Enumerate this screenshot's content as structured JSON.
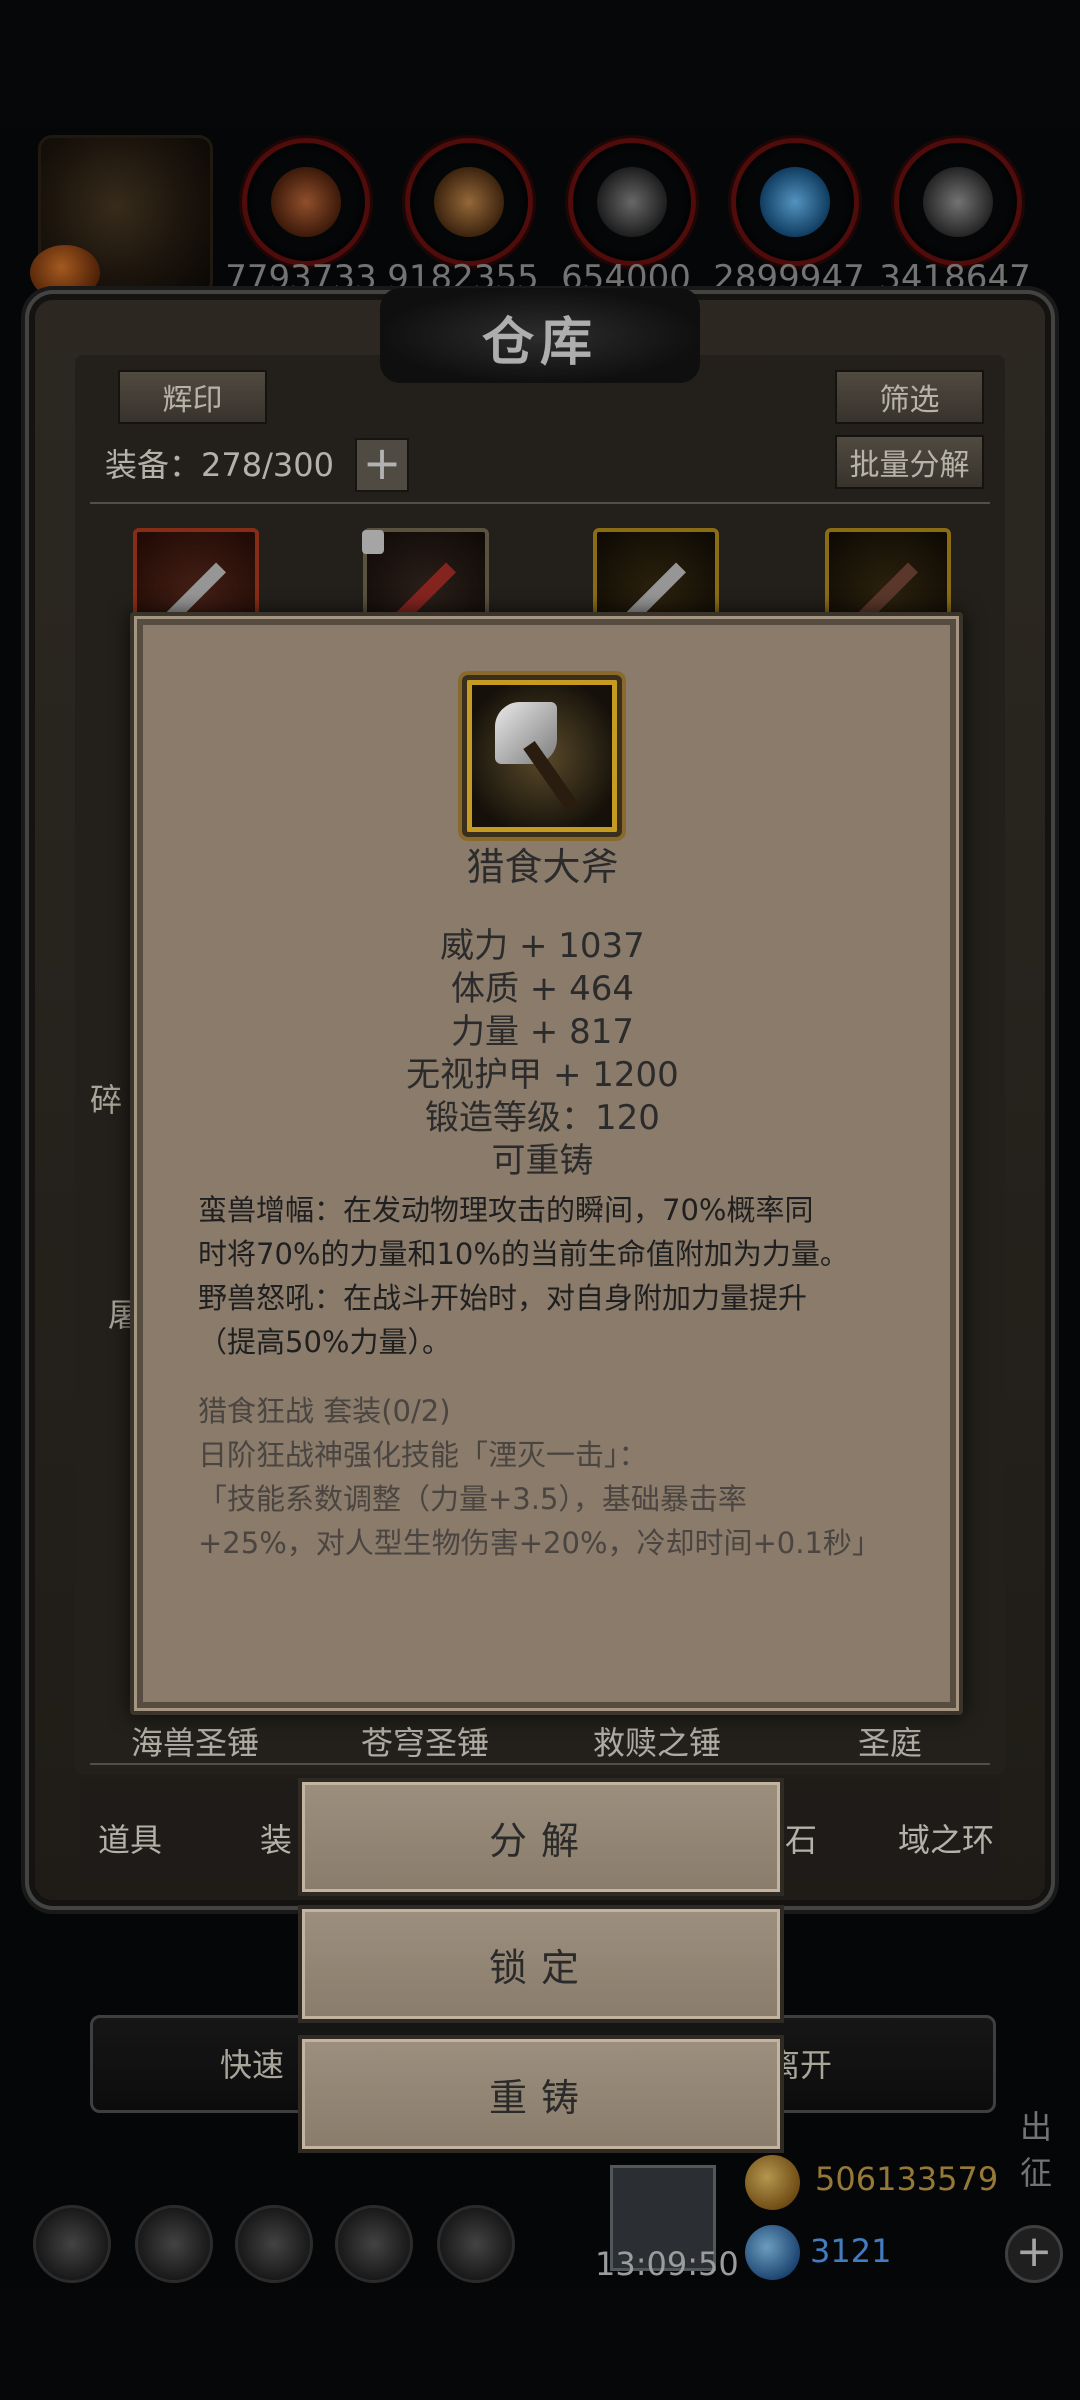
{
  "resources": {
    "values": [
      "7793733",
      "9182355",
      "654000",
      "2899947",
      "3418647"
    ]
  },
  "warehouse": {
    "title": "仓库",
    "emblem_button": "辉印",
    "filter_button": "筛选",
    "equip_label": "装备：278/300",
    "plus_symbol": "+",
    "batch_decompose_button": "批量分解"
  },
  "side_labels": {
    "left_1": "碎",
    "left_2": "屠"
  },
  "bottom_item_names": [
    "海兽圣锤",
    "苍穹圣锤",
    "救赎之锤",
    "圣庭"
  ],
  "tabs": {
    "items": "道具",
    "equip": "装",
    "stones": "石",
    "domain_rings": "域之环"
  },
  "quick_bar": {
    "left_text": "快速",
    "right_text": "离开"
  },
  "right_edge_text": "出征",
  "clock": "13:09:50",
  "currency": {
    "gold": "506133579",
    "diamond": "3121"
  },
  "popup": {
    "item_name": "猎食大斧",
    "stats": [
      "威力 + 1037",
      "体质 + 464",
      "力量 + 817",
      "无视护甲 + 1200",
      "锻造等级：120",
      "可重铸"
    ],
    "description_lines": [
      "蛮兽增幅：在发动物理攻击的瞬间，70%概率同",
      "时将70%的力量和10%的当前生命值附加为力量。",
      "野兽怒吼：在战斗开始时，对自身附加力量提升",
      "（提高50%力量）。"
    ],
    "set_lines": [
      "猎食狂战 套装(0/2)",
      "日阶狂战神强化技能「湮灭一击」：",
      "「技能系数调整（力量+3.5），基础暴击率",
      "+25%，对人型生物伤害+20%，冷却时间+0.1秒」"
    ]
  },
  "actions": {
    "decompose": "分解",
    "lock": "锁定",
    "reforge": "重铸"
  }
}
